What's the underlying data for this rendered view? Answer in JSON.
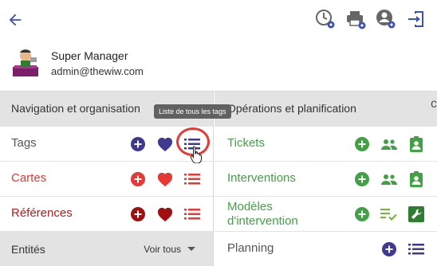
{
  "header": {
    "icons": [
      "back-arrow-icon",
      "history-settings-icon",
      "printer-settings-icon",
      "account-settings-icon",
      "logout-icon"
    ]
  },
  "profile": {
    "name": "Super Manager",
    "email": "admin@thewiw.com"
  },
  "left": {
    "title": "Navigation et organisation",
    "rows": [
      {
        "label": "Tags",
        "color": "#555555"
      },
      {
        "label": "Cartes",
        "color": "#e53935"
      },
      {
        "label": "Références",
        "color": "#b71c1c"
      }
    ],
    "entites_label": "Entités",
    "voir_tous": "Voir tous"
  },
  "right": {
    "title": "Opérations et planification",
    "rows": [
      {
        "label": "Tickets",
        "color": "#43a047"
      },
      {
        "label": "Interventions",
        "color": "#43a047"
      },
      {
        "label": "Modèles d'intervention",
        "line1": "Modèles",
        "line2": "d'intervention",
        "color": "#43a047"
      },
      {
        "label": "Planning",
        "color": "#555555"
      }
    ]
  },
  "tooltip": "Liste de tous les tags",
  "edge_char": "c",
  "colors": {
    "purple": "#3f3a8f",
    "red": "#e53935",
    "darkred": "#a01010",
    "green": "#43a047",
    "header_bg": "#e3e3e3"
  }
}
